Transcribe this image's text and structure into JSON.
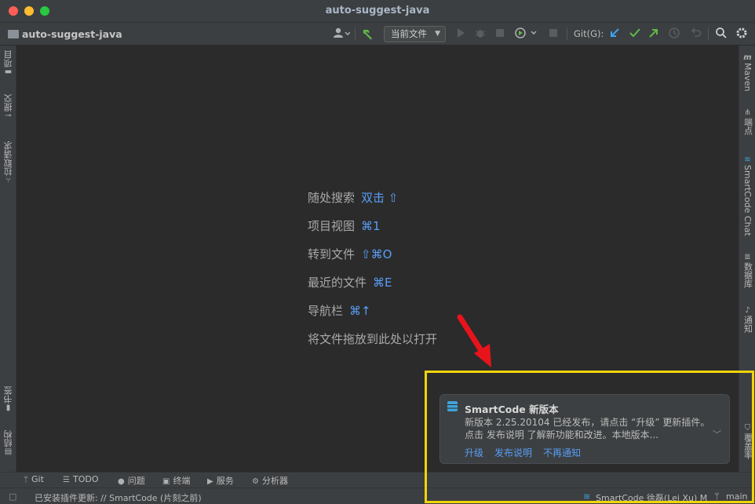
{
  "window": {
    "title": "auto-suggest-java"
  },
  "toolbar": {
    "project_name": "auto-suggest-java",
    "run_config": "当前文件",
    "git_label": "Git(G):"
  },
  "left_tabs": [
    {
      "label": "项目",
      "icon": "folder-icon"
    },
    {
      "label": "提交",
      "icon": "commit-icon"
    },
    {
      "label": "拉取请求",
      "icon": "pull-request-icon"
    },
    {
      "label": "书签",
      "icon": "bookmark-icon"
    },
    {
      "label": "结构",
      "icon": "structure-icon"
    }
  ],
  "right_tabs": [
    {
      "label": "Maven",
      "icon": "maven-icon"
    },
    {
      "label": "端点",
      "icon": "endpoints-icon"
    },
    {
      "label": "SmartCode Chat",
      "icon": "smartcode-icon"
    },
    {
      "label": "数据库",
      "icon": "database-icon"
    },
    {
      "label": "通知",
      "icon": "bell-icon"
    },
    {
      "label": "覆盖率",
      "icon": "coverage-icon"
    }
  ],
  "hints": [
    {
      "label": "随处搜索",
      "key": "双击 ⇧"
    },
    {
      "label": "项目视图",
      "key": "⌘1"
    },
    {
      "label": "转到文件",
      "key": "⇧⌘O"
    },
    {
      "label": "最近的文件",
      "key": "⌘E"
    },
    {
      "label": "导航栏",
      "key": "⌘↑"
    },
    {
      "label": "将文件拖放到此处以打开",
      "key": ""
    }
  ],
  "notification": {
    "title": "SmartCode 新版本",
    "body": "新版本 2.25.20104 已经发布，请点击 “升级” 更新插件。点击 发布说明 了解新功能和改进。本地版本...",
    "links": {
      "upgrade": "升级",
      "release_notes": "发布说明",
      "dismiss": "不再通知"
    }
  },
  "bottom_tabs": {
    "git": "Git",
    "todo": "TODO",
    "problems": "问题",
    "terminal": "终端",
    "services": "服务",
    "analyzer": "分析器"
  },
  "status": {
    "message": "已安装插件更新: // SmartCode (片刻之前)",
    "smartcode_user": "SmartCode 徐磊(Lei Xu) M",
    "branch": "main"
  },
  "colors": {
    "accent": "#589df6",
    "highlight": "#f0d40a",
    "arrow": "#e8141b"
  }
}
